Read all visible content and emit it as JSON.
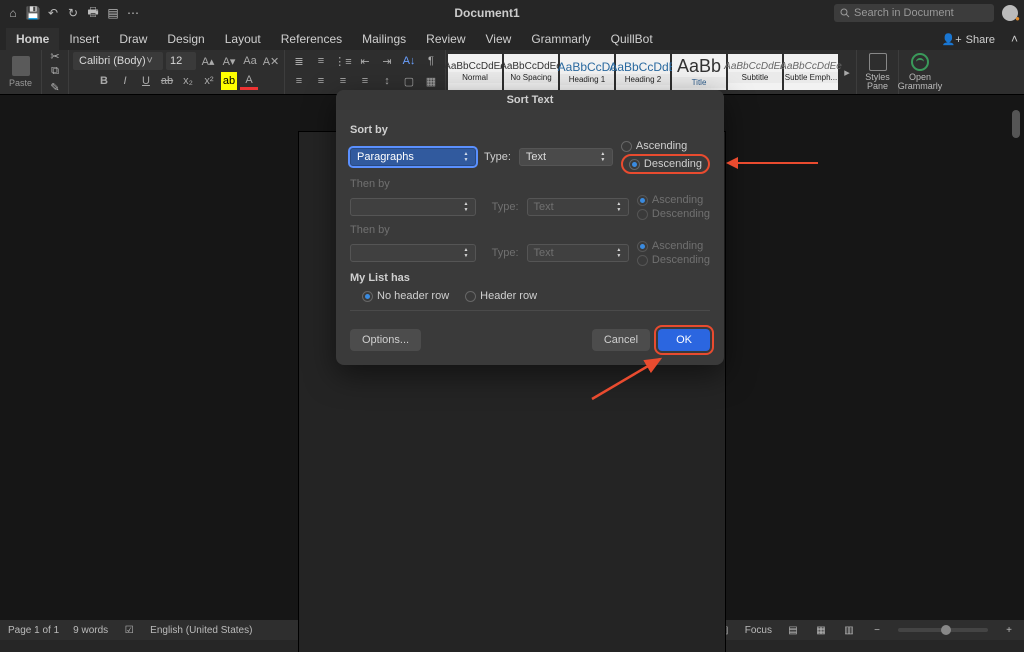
{
  "titlebar": {
    "doc_title": "Document1",
    "search_placeholder": "Search in Document"
  },
  "tabs": [
    "Home",
    "Insert",
    "Draw",
    "Design",
    "Layout",
    "References",
    "Mailings",
    "Review",
    "View",
    "Grammarly",
    "QuillBot"
  ],
  "active_tab": "Home",
  "share_label": "Share",
  "font": {
    "name": "Calibri (Body)",
    "size": "12"
  },
  "paste_label": "Paste",
  "styles": [
    {
      "sample": "AaBbCcDdEe",
      "label": "Normal"
    },
    {
      "sample": "AaBbCcDdEe",
      "label": "No Spacing"
    },
    {
      "sample": "AaBbCcDc",
      "label": "Heading 1"
    },
    {
      "sample": "AaBbCcDdE",
      "label": "Heading 2"
    },
    {
      "sample": "AaBb",
      "label": "Title"
    },
    {
      "sample": "AaBbCcDdEe",
      "label": "Subtitle"
    },
    {
      "sample": "AaBbCcDdEe",
      "label": "Subtle Emph..."
    }
  ],
  "styles_pane_label": "Styles Pane",
  "grammarly_btn_label": "Open Grammarly",
  "status": {
    "page": "Page 1 of 1",
    "words": "9 words",
    "language": "English (United States)",
    "focus": "Focus"
  },
  "dialog": {
    "title": "Sort Text",
    "sort_by": "Sort by",
    "then_by": "Then by",
    "type_label": "Type:",
    "field1_value": "Paragraphs",
    "type1_value": "Text",
    "type2_value": "Text",
    "type3_value": "Text",
    "ascending": "Ascending",
    "descending": "Descending",
    "my_list_has": "My List has",
    "no_header_row": "No header row",
    "header_row": "Header row",
    "options": "Options...",
    "cancel": "Cancel",
    "ok": "OK"
  }
}
